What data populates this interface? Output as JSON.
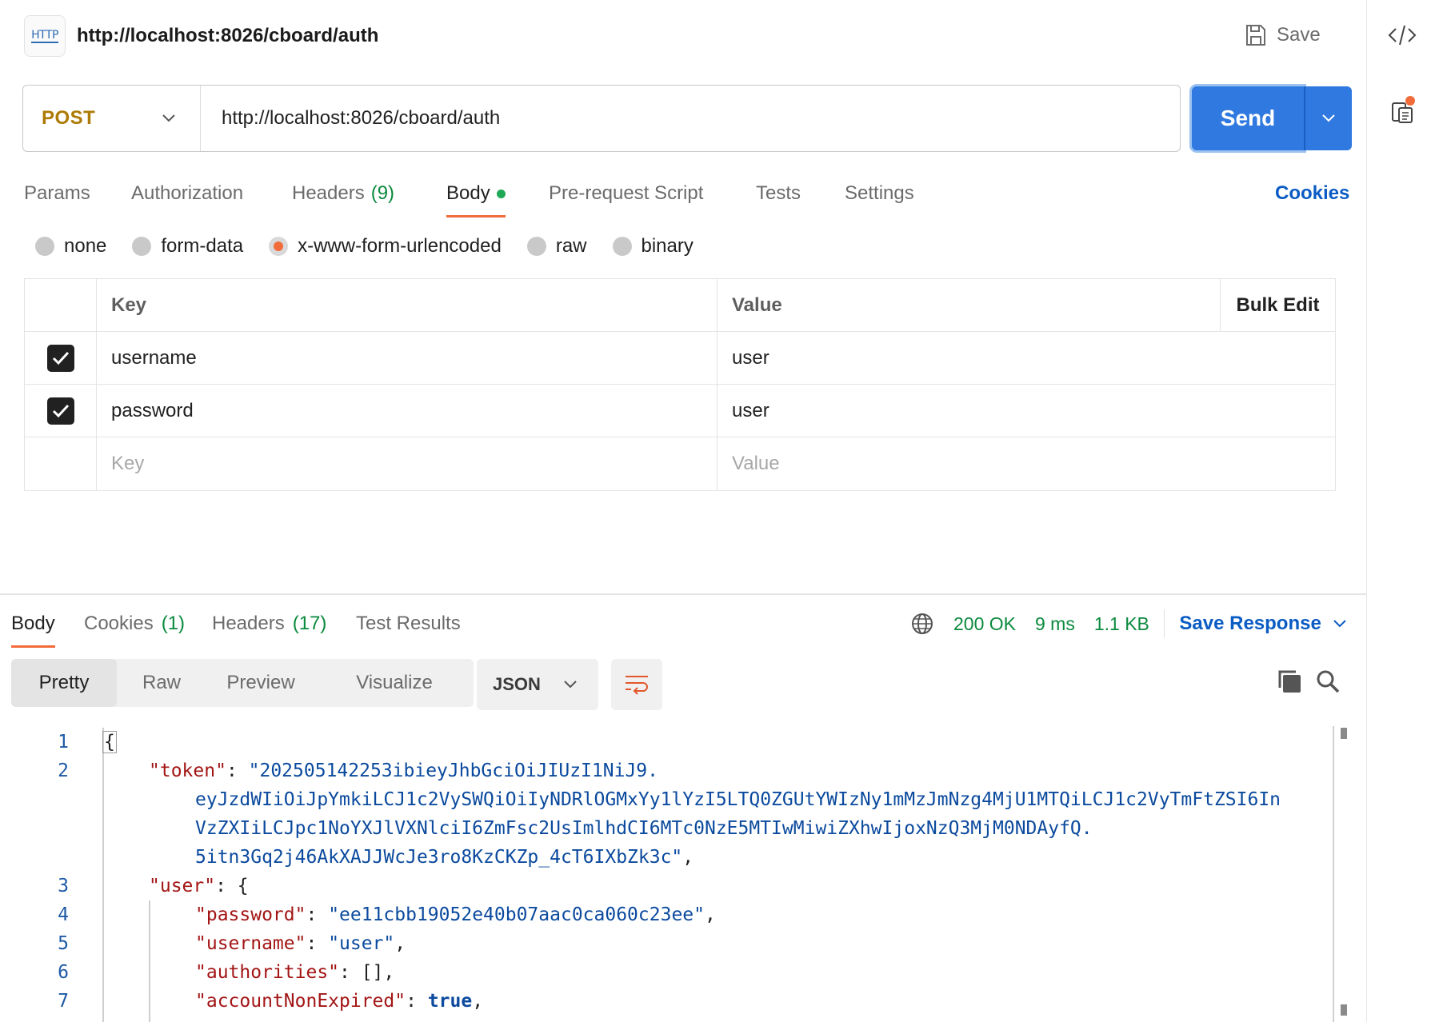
{
  "request": {
    "title": "http://localhost:8026/cboard/auth",
    "badge": "HTTP",
    "save_label": "Save",
    "method": "POST",
    "url": "http://localhost:8026/cboard/auth",
    "send_label": "Send"
  },
  "request_tabs": {
    "params": "Params",
    "authorization": "Authorization",
    "headers": "Headers",
    "headers_count": "(9)",
    "body": "Body",
    "prerequest": "Pre-request Script",
    "tests": "Tests",
    "settings": "Settings",
    "cookies": "Cookies"
  },
  "body_types": {
    "none": "none",
    "form_data": "form-data",
    "urlencoded": "x-www-form-urlencoded",
    "raw": "raw",
    "binary": "binary",
    "selected": "x-www-form-urlencoded"
  },
  "kv_table": {
    "key_header": "Key",
    "value_header": "Value",
    "bulk_edit": "Bulk Edit",
    "rows": [
      {
        "key": "username",
        "value": "user",
        "checked": true
      },
      {
        "key": "password",
        "value": "user",
        "checked": true
      }
    ],
    "key_placeholder": "Key",
    "value_placeholder": "Value"
  },
  "response_tabs": {
    "body": "Body",
    "cookies": "Cookies",
    "cookies_count": "(1)",
    "headers": "Headers",
    "headers_count": "(17)",
    "test_results": "Test Results"
  },
  "response_status": {
    "status": "200 OK",
    "time": "9 ms",
    "size": "1.1 KB",
    "save_response": "Save Response"
  },
  "view_modes": {
    "pretty": "Pretty",
    "raw": "Raw",
    "preview": "Preview",
    "visualize": "Visualize",
    "format": "JSON"
  },
  "code_lines": {
    "l1": {
      "n": "1",
      "text": "{"
    },
    "l2": {
      "n": "2",
      "key": "\"token\"",
      "value": "\"202505142253ibieyJhbGciOiJIUzI1NiJ9."
    },
    "l2b": "eyJzdWIiOiJpYmkiLCJ1c2VySWQiOiIyNDRlOGMxYy1lYzI5LTQ0ZGUtYWIzNy1mMzJmNzg4MjU1MTQiLCJ1c2VyTmFtZSI6In",
    "l2c": "VzZXIiLCJpc1NoYXJlVXNlciI6ZmFsc2UsImlhdCI6MTc0NzE5MTIwMiwiZXhwIjoxNzQ3MjM0NDAyfQ.",
    "l2d": "5itn3Gq2j46AkXAJJWcJe3ro8KzCKZp_4cT6IXbZk3c\"",
    "l3": {
      "n": "3",
      "key": "\"user\"",
      "rest": ": {"
    },
    "l4": {
      "n": "4",
      "key": "\"password\"",
      "value": "\"ee11cbb19052e40b07aac0ca060c23ee\""
    },
    "l5": {
      "n": "5",
      "key": "\"username\"",
      "value": "\"user\""
    },
    "l6": {
      "n": "6",
      "key": "\"authorities\"",
      "rest": ": [],"
    },
    "l7": {
      "n": "7",
      "key": "\"accountNonExpired\"",
      "value": "true"
    }
  },
  "icons": {
    "code": "code-icon",
    "docs": "docs-icon",
    "save": "save-icon",
    "globe": "globe-icon",
    "copy": "copy-icon",
    "search": "search-icon",
    "wrap": "wrap-lines-icon"
  },
  "colors": {
    "accent": "#f26b3a",
    "send": "#2f79e0",
    "method": "#ad7a03",
    "success": "#0b8a3e",
    "link": "#0a5cc4"
  }
}
